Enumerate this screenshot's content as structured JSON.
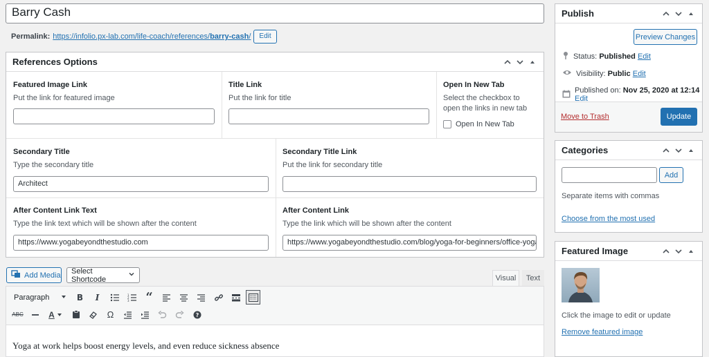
{
  "title": {
    "value": "Barry Cash"
  },
  "permalink": {
    "label": "Permalink:",
    "url_prefix": "https://infolio.px-lab.com/life-coach/references/",
    "slug": "barry-cash",
    "suffix": "/",
    "edit_label": "Edit"
  },
  "references": {
    "heading": "References Options",
    "featured_image_link": {
      "label": "Featured Image Link",
      "desc": "Put the link for featured image",
      "value": ""
    },
    "title_link": {
      "label": "Title Link",
      "desc": "Put the link for title",
      "value": ""
    },
    "open_new_tab": {
      "label": "Open In New Tab",
      "desc": "Select the checkbox to open the links in new tab",
      "checkbox_label": "Open In New Tab"
    },
    "secondary_title": {
      "label": "Secondary Title",
      "desc": "Type the secondary title",
      "value": "Architect"
    },
    "secondary_title_link": {
      "label": "Secondary Title Link",
      "desc": "Put the link for secondary title",
      "value": ""
    },
    "after_content_link_text": {
      "label": "After Content Link Text",
      "desc": "Type the link text which will be shown after the content",
      "value": "https://www.yogabeyondthestudio.com"
    },
    "after_content_link": {
      "label": "After Content Link",
      "desc": "Type the link which will be shown after the content",
      "value": "https://www.yogabeyondthestudio.com/blog/yoga-for-beginners/office-yoga"
    }
  },
  "editor": {
    "add_media_label": "Add Media",
    "shortcode_label": "Select Shortcode",
    "tab_visual": "Visual",
    "tab_text": "Text",
    "format_label": "Paragraph",
    "content": "Yoga at work helps boost energy levels, and even reduce sickness absence"
  },
  "publish": {
    "heading": "Publish",
    "preview_label": "Preview Changes",
    "status_label": "Status:",
    "status_value": "Published",
    "visibility_label": "Visibility:",
    "visibility_value": "Public",
    "published_label": "Published on:",
    "published_value": "Nov 25, 2020 at 12:14",
    "edit_label": "Edit",
    "trash_label": "Move to Trash",
    "update_label": "Update"
  },
  "categories": {
    "heading": "Categories",
    "add_label": "Add",
    "help": "Separate items with commas",
    "most_used_label": "Choose from the most used"
  },
  "featured_image": {
    "heading": "Featured Image",
    "help": "Click the image to edit or update",
    "remove_label": "Remove featured image"
  },
  "colors": {
    "accent": "#2271b1",
    "danger": "#b32d2e",
    "border": "#c3c4c7"
  }
}
